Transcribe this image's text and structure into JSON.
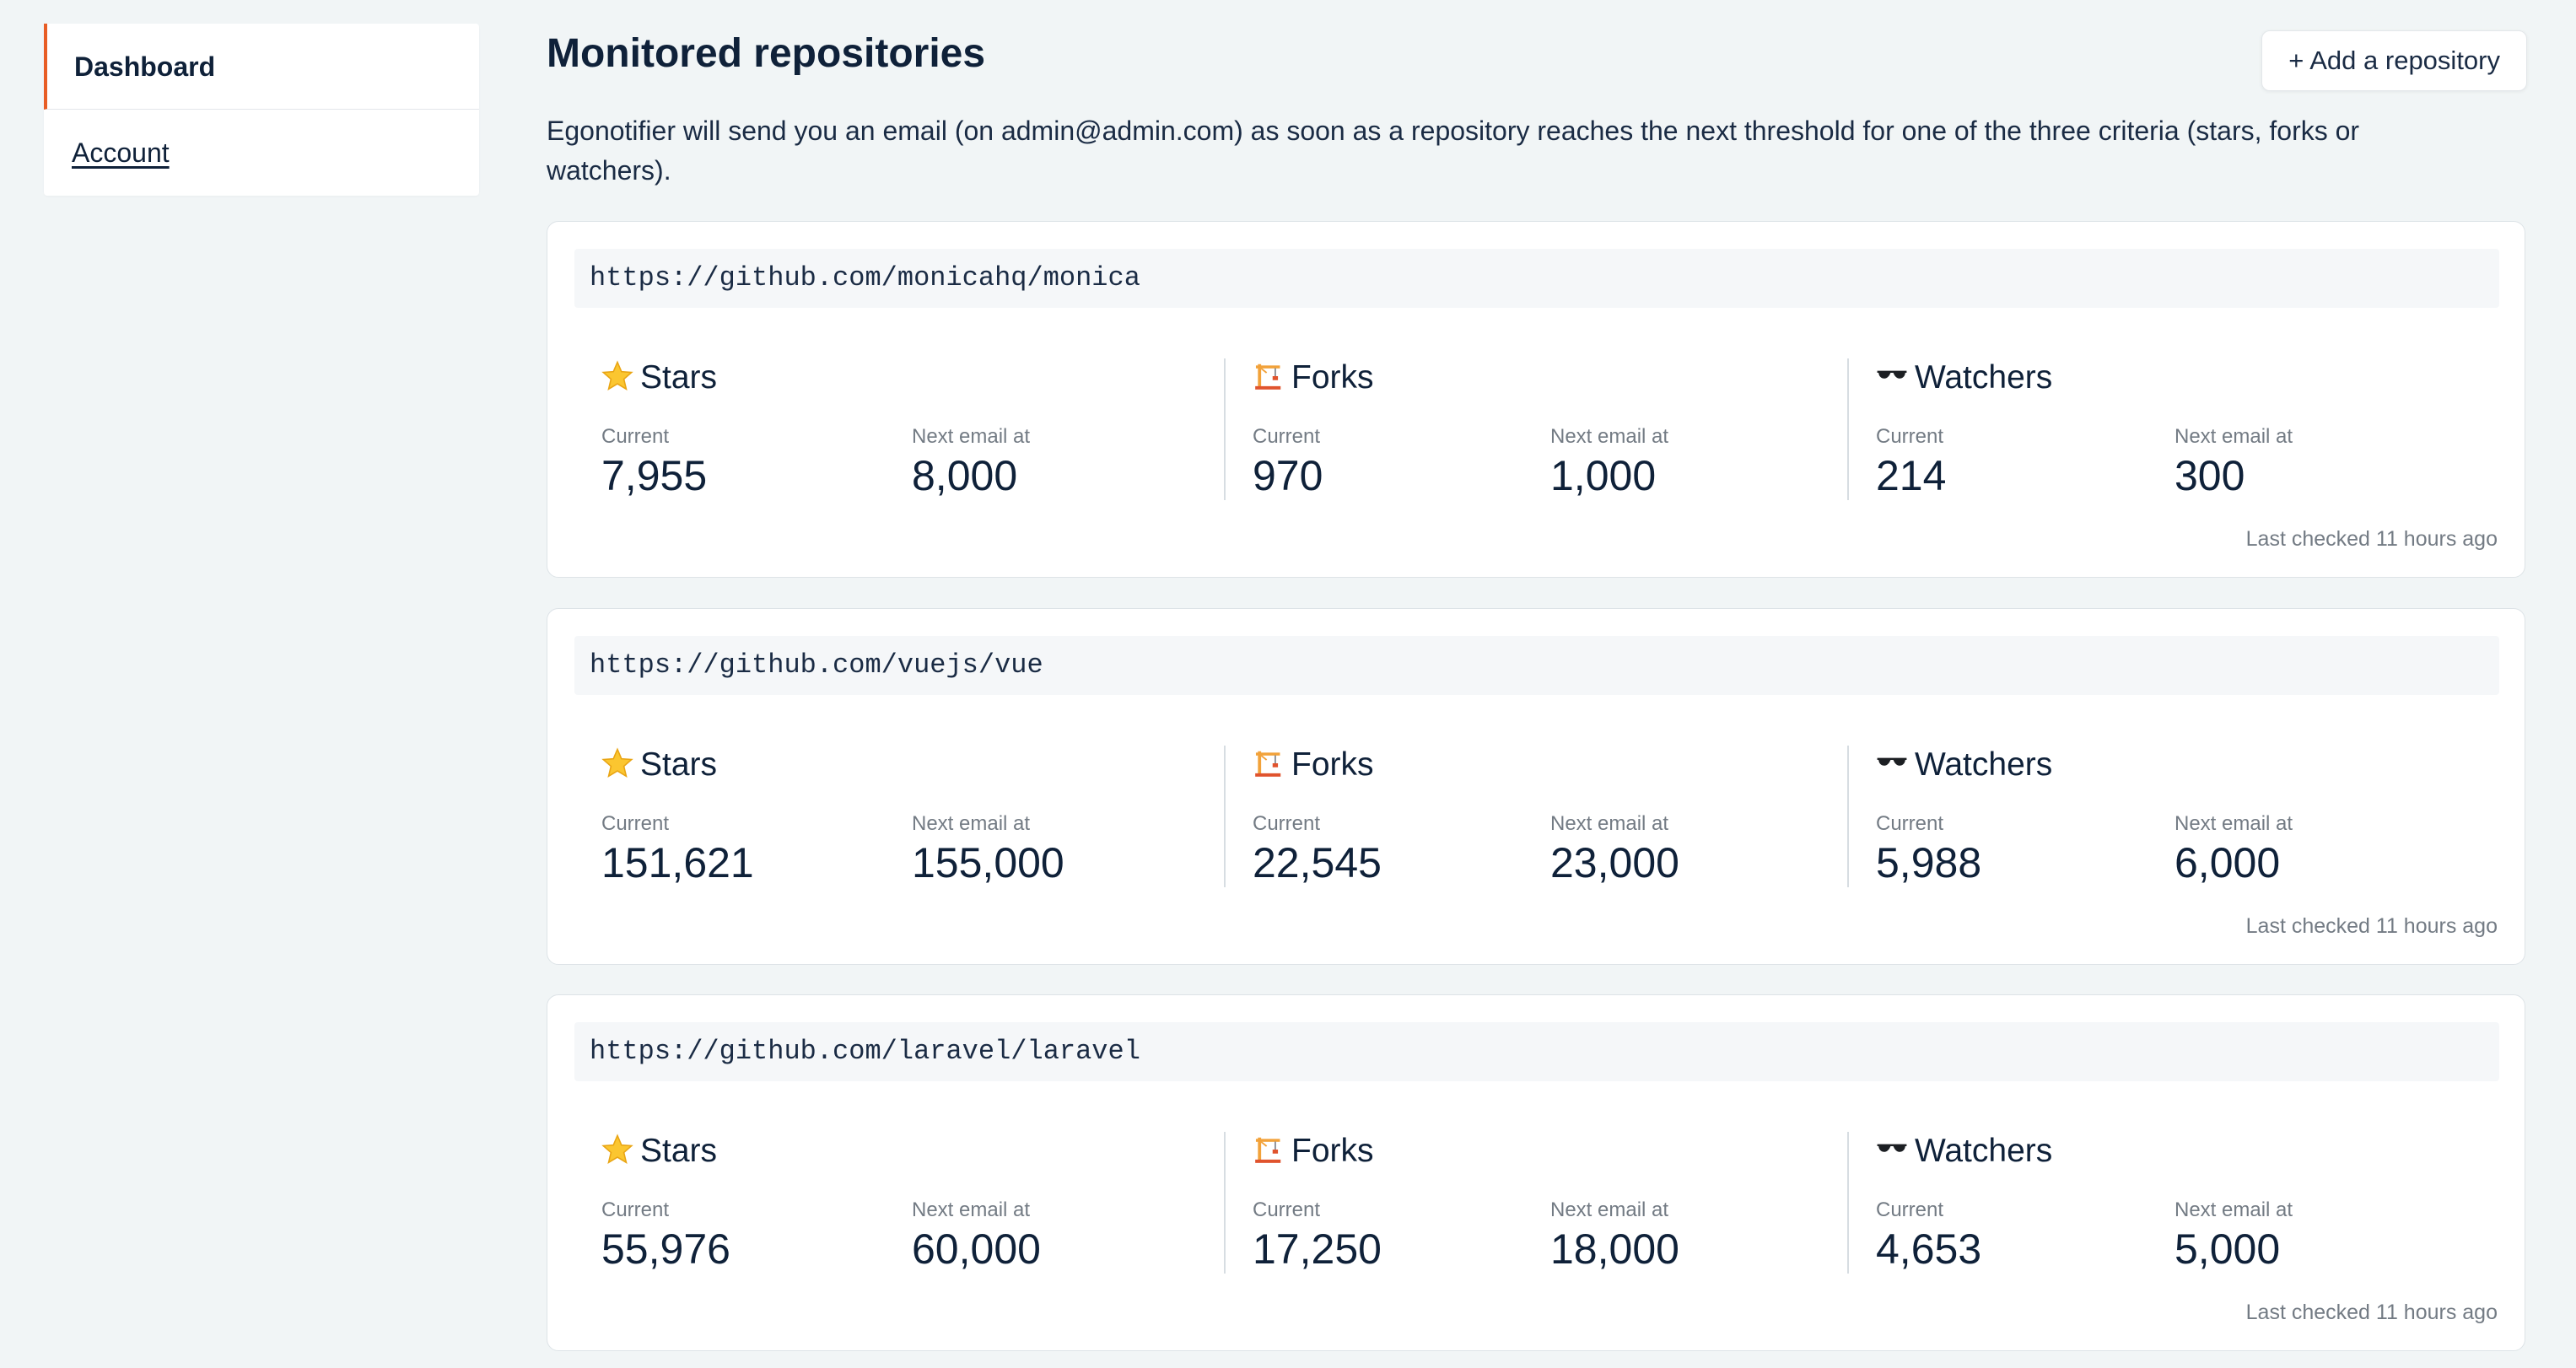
{
  "sidebar": {
    "items": [
      {
        "label": "Dashboard",
        "active": true
      },
      {
        "label": "Account",
        "active": false
      }
    ]
  },
  "header": {
    "title": "Monitored repositories",
    "add_button_label": "+ Add a repository"
  },
  "intro_text": "Egonotifier will send you an email (on admin@admin.com) as soon as a repository reaches the next threshold for one of the three criteria (stars, forks or watchers).",
  "labels": {
    "stars": "Stars",
    "forks": "Forks",
    "watchers": "Watchers",
    "current": "Current",
    "next_email": "Next email at"
  },
  "icons": {
    "stars": "star-icon",
    "forks": "crane-icon",
    "watchers": "sunglasses-icon"
  },
  "colors": {
    "accent": "#e85d25",
    "background": "#f1f5f6",
    "text": "#0f2139",
    "muted": "#737b84"
  },
  "repos": [
    {
      "url": "https://github.com/monicahq/monica",
      "stars": {
        "current": "7,955",
        "next": "8,000"
      },
      "forks": {
        "current": "970",
        "next": "1,000"
      },
      "watchers": {
        "current": "214",
        "next": "300"
      },
      "last_checked": "Last checked 11 hours ago"
    },
    {
      "url": "https://github.com/vuejs/vue",
      "stars": {
        "current": "151,621",
        "next": "155,000"
      },
      "forks": {
        "current": "22,545",
        "next": "23,000"
      },
      "watchers": {
        "current": "5,988",
        "next": "6,000"
      },
      "last_checked": "Last checked 11 hours ago"
    },
    {
      "url": "https://github.com/laravel/laravel",
      "stars": {
        "current": "55,976",
        "next": "60,000"
      },
      "forks": {
        "current": "17,250",
        "next": "18,000"
      },
      "watchers": {
        "current": "4,653",
        "next": "5,000"
      },
      "last_checked": "Last checked 11 hours ago"
    }
  ]
}
